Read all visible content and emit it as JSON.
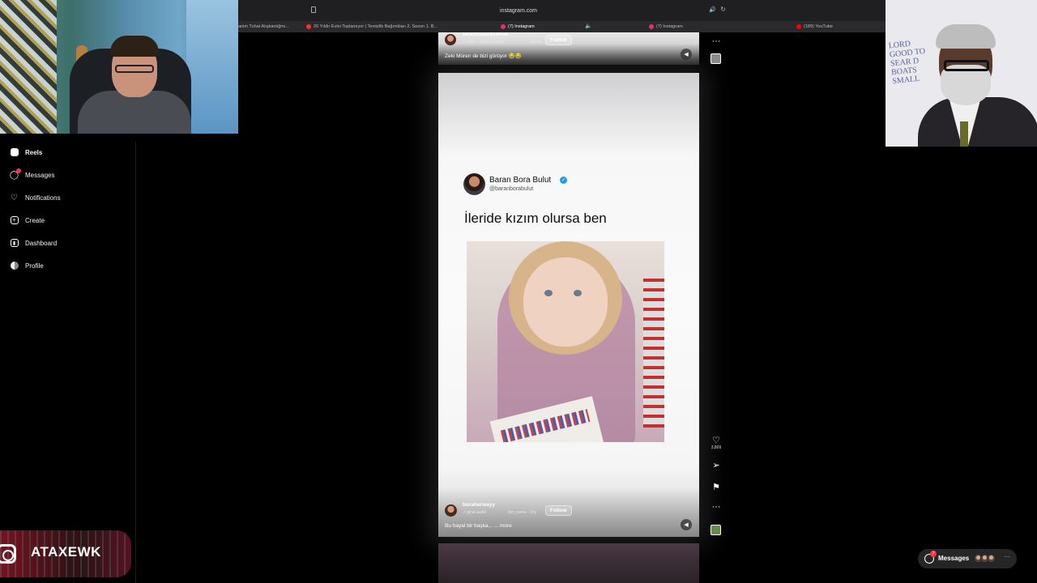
{
  "browser": {
    "url": "instagram.com",
    "tabs": [
      {
        "label": "anim Tuhat Alışkanlığmı...",
        "color": "#5a5a5a",
        "active": false
      },
      {
        "label": "20 Yıldır Evini Toplamıyor | Temizlik Bağımlıları 2. Sezon 1. B...",
        "color": "#ff2a2a",
        "active": false
      },
      {
        "label": "(7) Instagram",
        "color": "#e1306c",
        "active": true
      },
      {
        "label": "(7) Instagram",
        "color": "#e1306c",
        "active": false
      },
      {
        "label": "(189) YouTube",
        "color": "#ff0000",
        "active": false
      }
    ]
  },
  "sidebar": {
    "items": [
      {
        "label": "Reels",
        "icon": "reels-icon",
        "bold": true
      },
      {
        "label": "Messages",
        "icon": "messages-icon",
        "badge": true
      },
      {
        "label": "Notifications",
        "icon": "heart-icon"
      },
      {
        "label": "Create",
        "icon": "plus-square-icon"
      },
      {
        "label": "Dashboard",
        "icon": "dashboard-icon"
      },
      {
        "label": "Profile",
        "icon": "profile-avatar-icon"
      }
    ]
  },
  "brand": {
    "name": "ATAXEWK"
  },
  "prev_reel": {
    "username": "birazdusunmemek",
    "audio": "♫ ettim · Original audio",
    "extra": "ahmet",
    "follow": "Follow",
    "caption": "Zeki Müren de bizi görüyor 😂😂"
  },
  "reel": {
    "tweet_name": "Baran Bora Bulut",
    "tweet_handle": "@baranborabulut",
    "tweet_text": "İleride kızım olursa ben",
    "username": "boraharwayy",
    "audio": "♫ ginal audio",
    "tagged": "forr_name · Ory",
    "follow": "Follow",
    "caption": "Bu hayal bir başka... ... more",
    "likes": "3,809"
  },
  "messages_pill": {
    "label": "Messages",
    "count": "7",
    "more": "···"
  },
  "colors": {
    "accent": "#ff3040",
    "verified": "#1d9bf0",
    "background": "#000000"
  }
}
